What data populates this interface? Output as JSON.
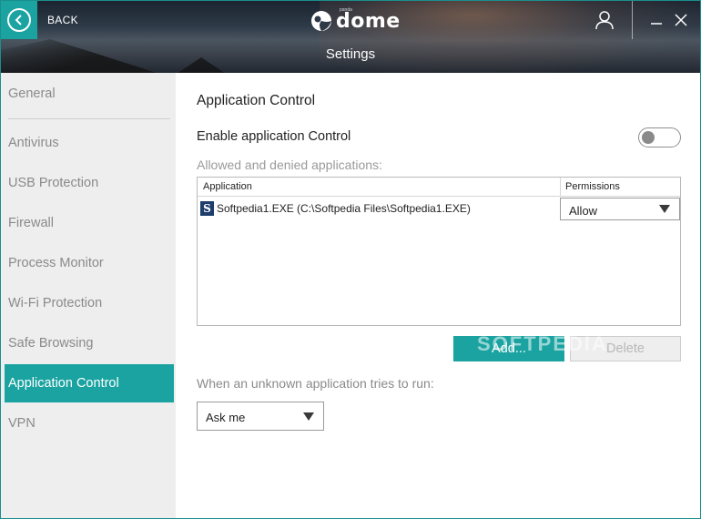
{
  "header": {
    "back_label": "BACK",
    "logo_text": "dome",
    "logo_small": "panda",
    "page_title": "Settings"
  },
  "sidebar": {
    "items": [
      {
        "label": "General",
        "active": false
      },
      {
        "label": "Antivirus",
        "active": false
      },
      {
        "label": "USB Protection",
        "active": false
      },
      {
        "label": "Firewall",
        "active": false
      },
      {
        "label": "Process Monitor",
        "active": false
      },
      {
        "label": "Wi-Fi Protection",
        "active": false
      },
      {
        "label": "Safe Browsing",
        "active": false
      },
      {
        "label": "Application Control",
        "active": true
      },
      {
        "label": "VPN",
        "active": false
      }
    ]
  },
  "main": {
    "section_title": "Application Control",
    "enable_label": "Enable application Control",
    "enable_state": false,
    "allowed_label": "Allowed and denied applications:",
    "table": {
      "columns": [
        "Application",
        "Permissions"
      ],
      "rows": [
        {
          "icon": "S",
          "application": "Softpedia1.EXE (C:\\Softpedia Files\\Softpedia1.EXE)",
          "permission": "Allow"
        }
      ]
    },
    "add_label": "Add...",
    "delete_label": "Delete",
    "unknown_label": "When an unknown application tries to run:",
    "unknown_value": "Ask me"
  },
  "watermark": "SOFTPEDIA",
  "colors": {
    "accent": "#1aa3a1",
    "sidebar_bg": "#eeeeee",
    "text_muted": "#8a8a8a"
  },
  "icons": {
    "back": "chevron-left-circle-icon",
    "user": "user-icon",
    "minimize": "minimize-icon",
    "close": "close-icon",
    "dropdown": "caret-down-icon"
  }
}
